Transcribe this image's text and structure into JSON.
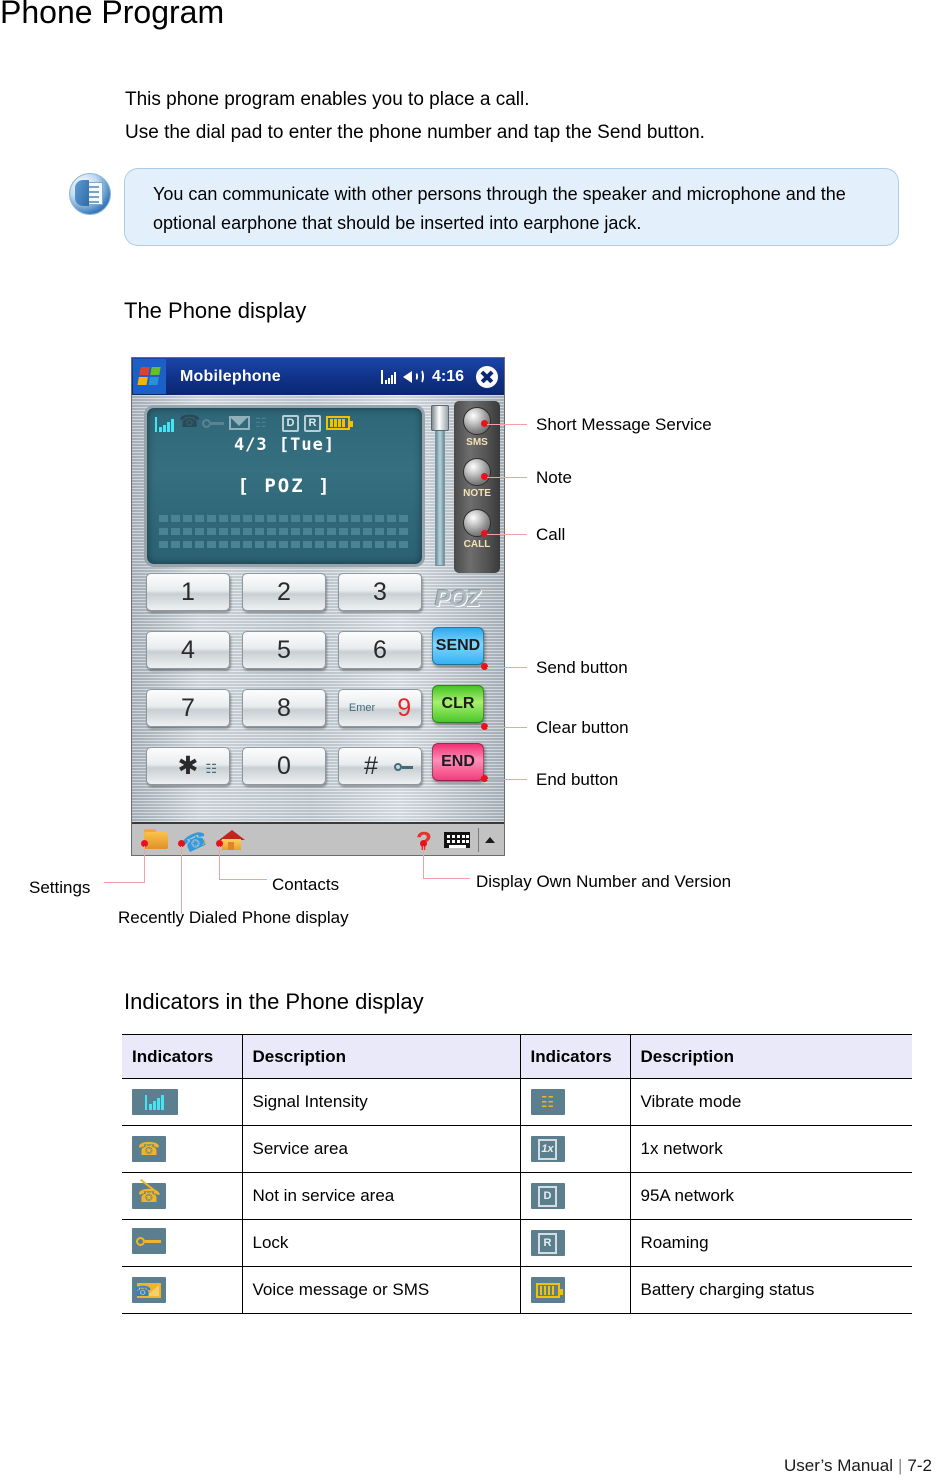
{
  "page": {
    "title": "Phone Program",
    "intro_line_1": "This phone program enables you to place a call.",
    "intro_line_2": "Use the dial pad to enter the phone number and tap the Send button.",
    "note_text": "You can communicate with other persons through the speaker and microphone and the optional earphone that should be inserted into earphone jack.",
    "heading_phone_display": "The Phone display",
    "heading_indicators": "Indicators in the Phone display",
    "footer_manual": "User’s Manual",
    "footer_page": "7-2"
  },
  "pda": {
    "title": "Mobilephone",
    "time": "4:16",
    "lcd": {
      "date": "4/3 [Tue]",
      "network": "[ POZ ]"
    },
    "side_buttons": [
      {
        "label": "SMS"
      },
      {
        "label": "NOTE"
      },
      {
        "label": "CALL"
      }
    ],
    "brand": "POZ",
    "keys": [
      {
        "label": "1"
      },
      {
        "label": "2"
      },
      {
        "label": "3"
      },
      {
        "label": "4"
      },
      {
        "label": "5"
      },
      {
        "label": "6"
      },
      {
        "label": "7"
      },
      {
        "label": "8"
      },
      {
        "label": "9",
        "sub": "Emer"
      },
      {
        "label": "✱"
      },
      {
        "label": "0"
      },
      {
        "label": "#"
      }
    ],
    "function_keys": [
      {
        "label": "SEND",
        "color": "#36b2f2"
      },
      {
        "label": "CLR",
        "color": "#4cc72b"
      },
      {
        "label": "END",
        "color": "#f23d7d"
      }
    ]
  },
  "callouts": {
    "right": [
      {
        "label": "Short Message Service"
      },
      {
        "label": "Note"
      },
      {
        "label": "Call"
      },
      {
        "label": "Send button"
      },
      {
        "label": "Clear button"
      },
      {
        "label": "End button"
      }
    ],
    "bottom": [
      {
        "label": "Settings"
      },
      {
        "label": "Recently Dialed Phone display"
      },
      {
        "label": "Contacts"
      },
      {
        "label": "Display Own Number and Version"
      }
    ]
  },
  "indicators_table": {
    "headers": [
      "Indicators",
      "Description",
      "Indicators",
      "Description"
    ],
    "rows": [
      {
        "desc_left": "Signal Intensity",
        "desc_right": "Vibrate mode"
      },
      {
        "desc_left": "Service area",
        "desc_right": "1x network"
      },
      {
        "desc_left": "Not in service area",
        "desc_right": "95A network"
      },
      {
        "desc_left": "Lock",
        "desc_right": "Roaming"
      },
      {
        "desc_left": "Voice message or SMS",
        "desc_right": "Battery charging status"
      }
    ],
    "net_glyphs": {
      "onex": "1x",
      "d": "D",
      "r": "R"
    }
  },
  "colors": {
    "callout_line": "#f2a0a0",
    "callout_dot": "#e8121c",
    "note_bg": "#e3f0fb",
    "table_header_bg": "#e9e9fa",
    "titlebar": "#103288"
  }
}
